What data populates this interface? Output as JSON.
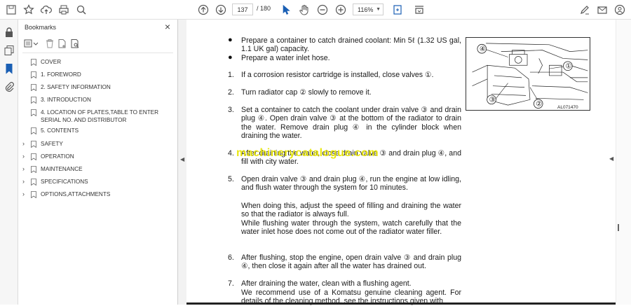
{
  "toolbar": {
    "page_current": "137",
    "page_total": "/ 180",
    "zoom": "116%"
  },
  "bookmarks": {
    "title": "Bookmarks",
    "items": [
      {
        "label": "COVER",
        "expandable": false
      },
      {
        "label": "1. FOREWORD",
        "expandable": false
      },
      {
        "label": "2. SAFETY INFORMATION",
        "expandable": false
      },
      {
        "label": "3. INTRODUCTION",
        "expandable": false
      },
      {
        "label": "4. LOCATION OF PLATES,TABLE TO ENTER SERIAL NO. AND DISTRIBUTOR",
        "expandable": false
      },
      {
        "label": "5. CONTENTS",
        "expandable": false
      },
      {
        "label": "SAFETY",
        "expandable": true
      },
      {
        "label": "OPERATION",
        "expandable": true
      },
      {
        "label": "MAINTENANCE",
        "expandable": true
      },
      {
        "label": "SPECIFICATIONS",
        "expandable": true
      },
      {
        "label": "OPTIONS,ATTACHMENTS",
        "expandable": true
      }
    ]
  },
  "document": {
    "bullet1": "Prepare a container to catch drained coolant: Min 5ℓ (1.32 US gal, 1.1 UK gal) capacity.",
    "bullet2": "Prepare a water inlet hose.",
    "steps": [
      {
        "num": "1.",
        "text": "If a corrosion resistor cartridge is installed, close valves ①."
      },
      {
        "num": "2.",
        "text": "Turn radiator cap ② slowly to remove it."
      },
      {
        "num": "3.",
        "text": "Set a container to catch the coolant under drain valve ③ and drain plug ④. Open drain valve ③ at the bottom of the radiator to drain the water. Remove drain plug ④ in the cylinder block when draining the water."
      },
      {
        "num": "4.",
        "text": "After draining the water, close drain valve ③ and drain plug ④, and fill with city water."
      },
      {
        "num": "5.",
        "text": "Open drain valve ③ and drain plug ④, run the engine at low idling, and flush water through the system for 10 minutes."
      },
      {
        "num": "",
        "text": "When doing this, adjust the speed of filling and draining the water so that the radiator is always full."
      },
      {
        "num": "",
        "text": "While flushing water through the system, watch carefully that the water inlet hose does not come out of the radiator water filler."
      },
      {
        "num": "6.",
        "text": "After flushing, stop the engine, open drain valve ③ and drain plug ④, then close it again after all the water has drained out."
      },
      {
        "num": "7.",
        "text": "After draining the water, clean with a flushing agent."
      },
      {
        "num": "",
        "text": "We recommend use of a Komatsu genuine cleaning agent. For details of the cleaning method, see the instructions given with"
      }
    ],
    "watermark": "machinerycatalogue.com",
    "figure_label": "AL071470",
    "callouts": [
      "①",
      "②",
      "③",
      "④"
    ]
  }
}
